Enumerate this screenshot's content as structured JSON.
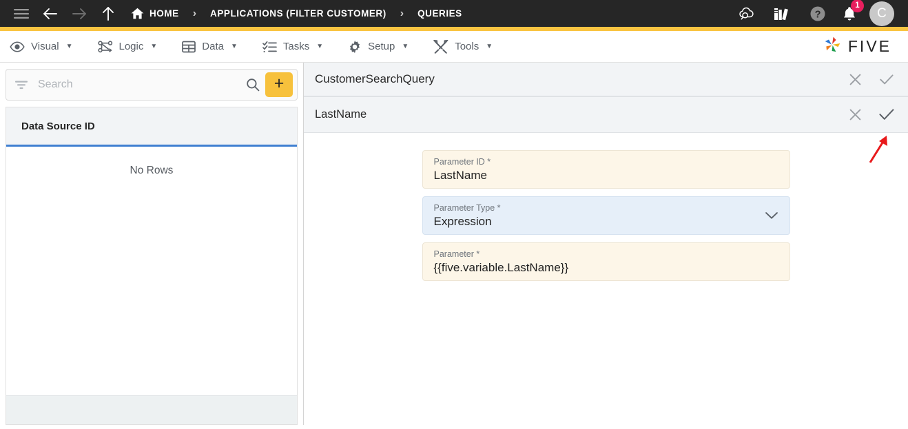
{
  "topbar": {
    "menu_icon": "hamburger-menu-icon",
    "back_icon": "arrow-left-icon",
    "forward_icon": "arrow-right-icon",
    "up_icon": "arrow-up-icon",
    "breadcrumbs": [
      {
        "label": "HOME",
        "icon": "home-icon"
      },
      {
        "label": "APPLICATIONS (FILTER CUSTOMER)",
        "icon": ""
      },
      {
        "label": "QUERIES",
        "icon": ""
      }
    ],
    "separator": "›",
    "right_icons": [
      {
        "name": "cloud-search-icon"
      },
      {
        "name": "books-library-icon"
      },
      {
        "name": "help-question-icon"
      },
      {
        "name": "notification-bell-icon"
      }
    ],
    "notification_count": "1",
    "avatar_initial": "C",
    "accent_bar_color": "#F9C441",
    "background_color": "#262626"
  },
  "menubar": {
    "items": [
      {
        "label": "Visual",
        "icon": "eye-icon",
        "caret": "▼"
      },
      {
        "label": "Logic",
        "icon": "logic-nodes-icon",
        "caret": "▼"
      },
      {
        "label": "Data",
        "icon": "table-grid-icon",
        "caret": "▼"
      },
      {
        "label": "Tasks",
        "icon": "checklist-icon",
        "caret": "▼"
      },
      {
        "label": "Setup",
        "icon": "gear-icon",
        "caret": "▼"
      },
      {
        "label": "Tools",
        "icon": "tools-wrench-icon",
        "caret": "▼"
      }
    ],
    "brand_text": "FIVE",
    "brand_icon": "five-pinwheel-logo"
  },
  "sidebar": {
    "search": {
      "placeholder": "Search",
      "value": "",
      "filter_icon": "filter-icon",
      "search_icon": "search-icon"
    },
    "add_button_label": "+",
    "add_button_color": "#F7C13C",
    "grid": {
      "column_header": "Data Source ID",
      "header_underline_color": "#3f7fd1",
      "empty_message": "No Rows"
    }
  },
  "main": {
    "query_panel": {
      "title": "CustomerSearchQuery",
      "close_icon": "close-x-icon",
      "confirm_icon": "checkmark-icon"
    },
    "parameter_panel": {
      "title": "LastName",
      "close_icon": "close-x-icon",
      "confirm_icon": "checkmark-icon"
    },
    "fields": [
      {
        "label": "Parameter ID *",
        "value": "LastName",
        "style": "cream",
        "control": "text"
      },
      {
        "label": "Parameter Type *",
        "value": "Expression",
        "style": "blue",
        "control": "select",
        "chevron_icon": "chevron-down-icon"
      },
      {
        "label": "Parameter *",
        "value": "{{five.variable.LastName}}",
        "style": "cream",
        "control": "text"
      }
    ]
  },
  "annotation": {
    "arrow_icon": "red-arrow-pointer",
    "arrow_color": "#E8191B"
  }
}
